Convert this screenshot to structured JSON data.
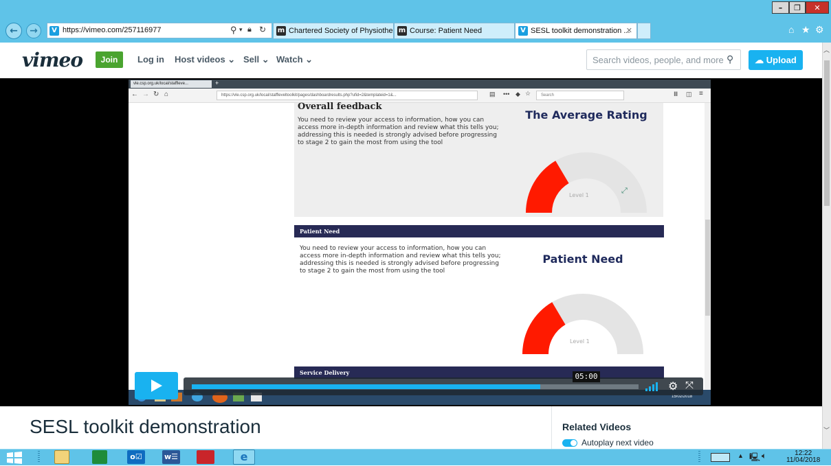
{
  "browser": {
    "address_url": "https://vimeo.com/257116977",
    "tabs": [
      {
        "label": "Chartered Society of Physiothe...",
        "favicon": "m"
      },
      {
        "label": "Course: Patient Need",
        "favicon": "m"
      },
      {
        "label": "SESL toolkit demonstration ...",
        "favicon": "v",
        "active": true
      }
    ],
    "close_glyph": "✕",
    "new_tab_glyph": "+"
  },
  "vimeo": {
    "logo": "vimeo",
    "join_label": "Join",
    "nav": [
      "Log in",
      "Host videos ⌄",
      "Sell ⌄",
      "Watch ⌄"
    ],
    "search_placeholder": "Search videos, people, and more",
    "upload_label": "Upload"
  },
  "recording": {
    "tab_label": "vle.csp.org.uk/local/staffleve...",
    "url": "https://vle.csp.org.uk/local/staffleveltoolkit/pages/dashboardresults.php?ufid=2&templateid=1&...",
    "search_placeholder": "Search",
    "overall_heading": "Overall feedback",
    "overall_text": "You need to review your access to information, how you can access more in-depth information and review what this tells you; addressing this is needed is strongly advised before progressing to stage 2 to gain the most from using the tool",
    "gauge1_title": "The Average Rating",
    "gauge1_level": "Level 1",
    "gauge1_value": 0.33,
    "section1": "Patient Need",
    "patient_text": "You need to review your access to information, how you can access more in-depth information and review what this tells you; addressing this is needed is strongly advised before progressing to stage 2 to gain the most from using the tool",
    "gauge2_title": "Patient Need",
    "gauge2_level": "Level 1",
    "gauge2_value": 0.33,
    "section2": "Service Delivery",
    "rec_date": "15/02/2018"
  },
  "player": {
    "time": "05:00",
    "progress": 0.78
  },
  "video_title": "SESL toolkit demonstration",
  "related": {
    "heading": "Related Videos",
    "autoplay_label": "Autoplay next video"
  },
  "taskbar": {
    "time": "12:22",
    "date": "11/04/2018"
  },
  "colors": {
    "ie_chrome": "#5fc3e8",
    "vimeo_green": "#4aa42f",
    "vimeo_blue": "#19b2f0",
    "gauge_red": "#ff1a00",
    "section_navy": "#272a55"
  }
}
